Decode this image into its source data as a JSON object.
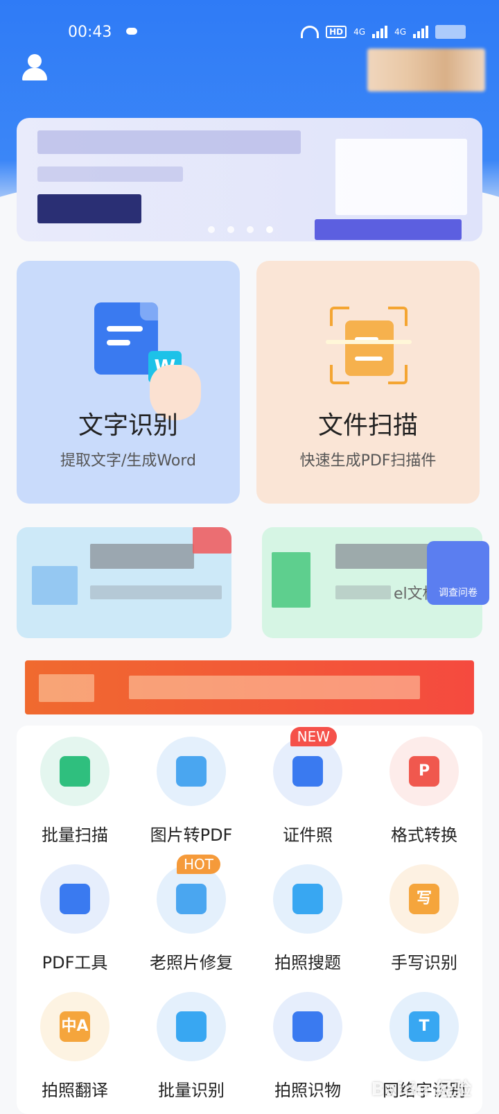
{
  "status_bar": {
    "time": "00:43",
    "network_badge": "HD",
    "signal_1": "4G",
    "signal_2": "4G"
  },
  "header": {
    "user_icon": "user-icon"
  },
  "main_cards": [
    {
      "title": "文字识别",
      "subtitle": "提取文字/生成Word",
      "badge_letter": "W",
      "color": "#c9dbfb"
    },
    {
      "title": "文件扫描",
      "subtitle": "快速生成PDF扫描件",
      "color": "#fae5d6"
    }
  ],
  "secondary_cards": [
    {
      "caption": ""
    },
    {
      "caption": "el文档"
    }
  ],
  "survey": {
    "label": "调查问卷"
  },
  "tools": [
    {
      "label": "批量扫描",
      "icon": "batch-scan-icon",
      "bg": "#e4f6ef",
      "fg": "#2fbf7e",
      "glyph": ""
    },
    {
      "label": "图片转PDF",
      "icon": "image-to-pdf-icon",
      "bg": "#e4f0fc",
      "fg": "#4aa6f0",
      "glyph": ""
    },
    {
      "label": "证件照",
      "icon": "id-photo-icon",
      "bg": "#e6eefc",
      "fg": "#3a7af0",
      "glyph": "",
      "tag": "NEW"
    },
    {
      "label": "格式转换",
      "icon": "format-convert-icon",
      "bg": "#fdecea",
      "fg": "#f0584e",
      "glyph": "P"
    },
    {
      "label": "PDF工具",
      "icon": "pdf-tools-icon",
      "bg": "#e6eefc",
      "fg": "#3a7af0",
      "glyph": ""
    },
    {
      "label": "老照片修复",
      "icon": "photo-restore-icon",
      "bg": "#e4f0fc",
      "fg": "#4aa6f0",
      "glyph": "",
      "tag": "HOT"
    },
    {
      "label": "拍照搜题",
      "icon": "camera-search-icon",
      "bg": "#e4f0fc",
      "fg": "#38a7f2",
      "glyph": ""
    },
    {
      "label": "手写识别",
      "icon": "handwriting-icon",
      "bg": "#fdf1e2",
      "fg": "#f5a53c",
      "glyph": "写"
    },
    {
      "label": "拍照翻译",
      "icon": "photo-translate-icon",
      "bg": "#fdf3e2",
      "fg": "#f5a53c",
      "glyph": "中A"
    },
    {
      "label": "批量识别",
      "icon": "batch-recognize-icon",
      "bg": "#e4f0fc",
      "fg": "#38a7f2",
      "glyph": ""
    },
    {
      "label": "拍照识物",
      "icon": "object-recognize-icon",
      "bg": "#e6eefc",
      "fg": "#3a7af0",
      "glyph": ""
    },
    {
      "label": "网络字识别",
      "icon": "web-text-icon",
      "bg": "#e4f0fc",
      "fg": "#38a7f2",
      "glyph": "T"
    }
  ],
  "watermark": "Baidu 经验"
}
